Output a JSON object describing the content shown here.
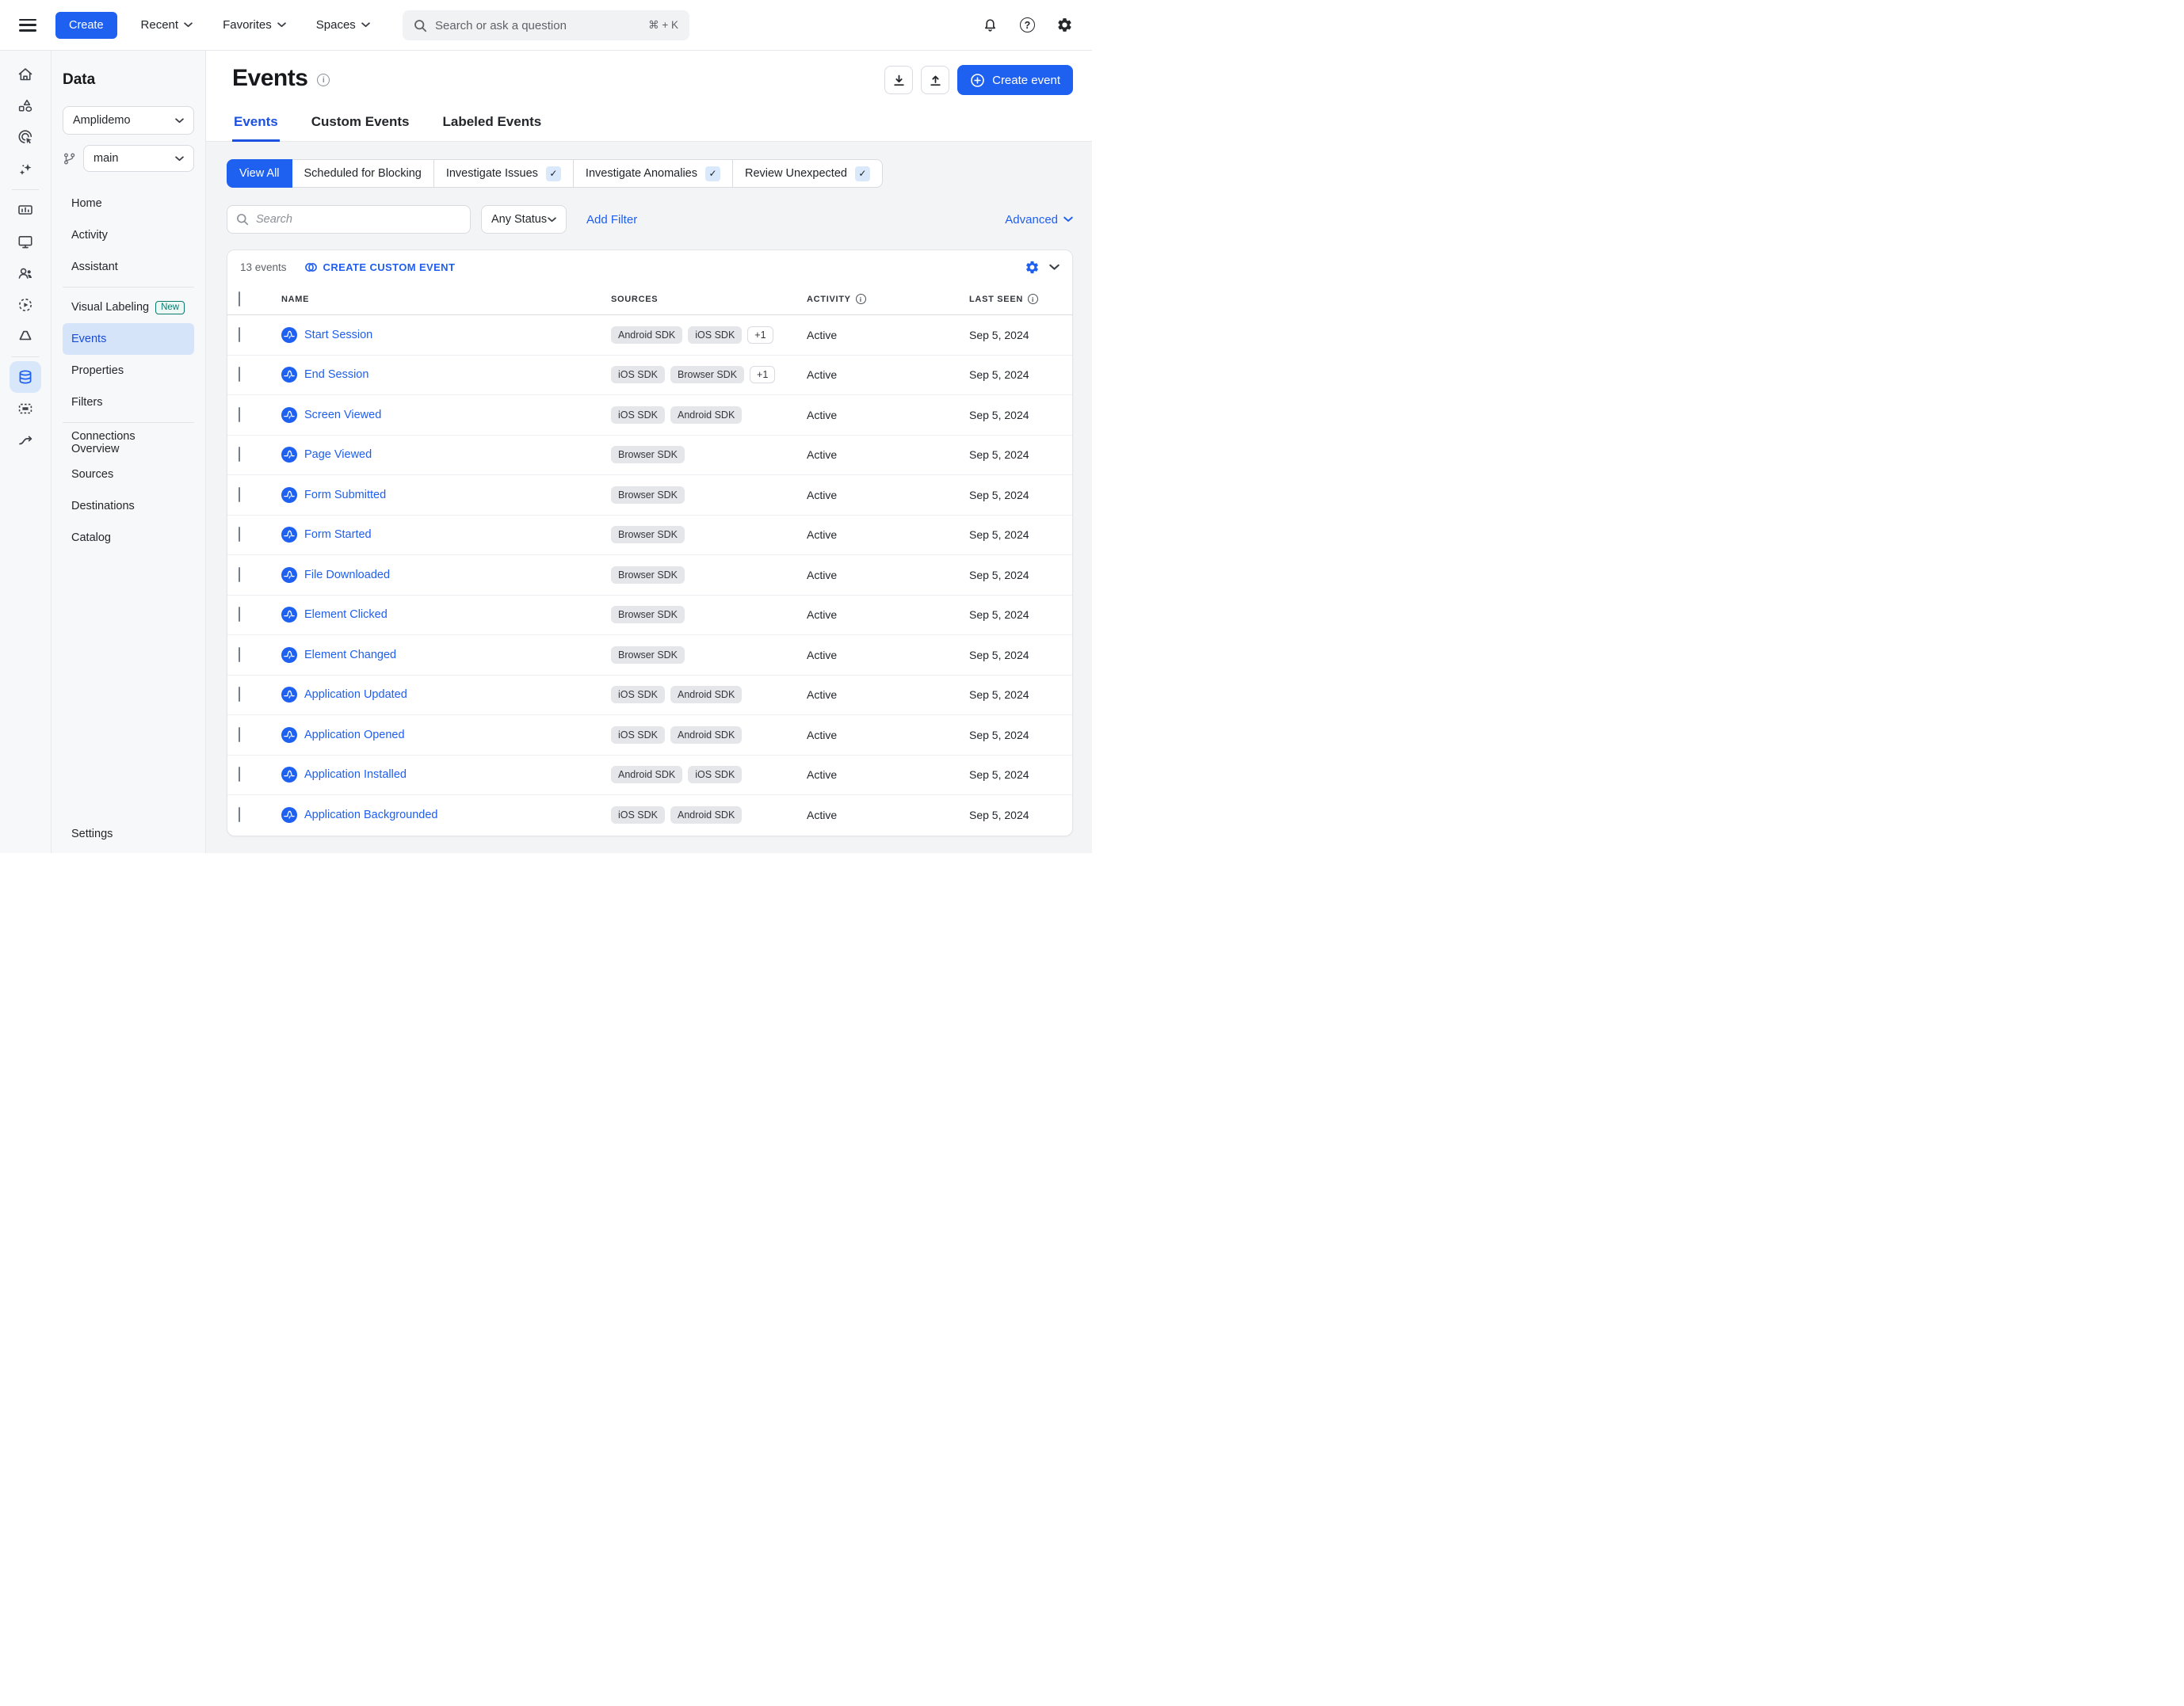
{
  "colors": {
    "accent": "#1E61F0",
    "link": "#1E5EF0",
    "active_nav_bg": "#D6E4FA",
    "page_bg": "#F3F4F6"
  },
  "topbar": {
    "create_label": "Create",
    "menus": [
      {
        "label": "Recent"
      },
      {
        "label": "Favorites"
      },
      {
        "label": "Spaces"
      }
    ],
    "search": {
      "placeholder": "Search or ask a question",
      "shortcut": "⌘ + K"
    },
    "right_icons": [
      "notifications-bell",
      "help-circle",
      "settings-gear"
    ]
  },
  "rail": {
    "items": [
      "home",
      "objects",
      "web-click",
      "ai-sparkles",
      "dashboards",
      "displays",
      "users",
      "session-replay",
      "experiments",
      "data",
      "selection-frame",
      "journeys"
    ],
    "active": "data"
  },
  "sidebar": {
    "title": "Data",
    "project_selector": "Amplidemo",
    "branch_selector": "main",
    "nav": [
      {
        "label": "Home"
      },
      {
        "label": "Activity"
      },
      {
        "label": "Assistant"
      },
      {
        "label": "Visual Labeling",
        "badge": "New"
      },
      {
        "label": "Events",
        "active": true
      },
      {
        "label": "Properties"
      },
      {
        "label": "Filters"
      },
      {
        "label": "Connections Overview"
      },
      {
        "label": "Sources"
      },
      {
        "label": "Destinations"
      },
      {
        "label": "Catalog"
      }
    ],
    "settings_label": "Settings"
  },
  "main": {
    "title": "Events",
    "create_event_label": "Create event",
    "tabs": [
      {
        "label": "Events",
        "active": true
      },
      {
        "label": "Custom Events"
      },
      {
        "label": "Labeled Events"
      }
    ],
    "filters": {
      "segments": [
        {
          "label": "View All",
          "active": true
        },
        {
          "label": "Scheduled for Blocking"
        },
        {
          "label": "Investigate Issues",
          "check": "✓"
        },
        {
          "label": "Investigate Anomalies",
          "check": "✓"
        },
        {
          "label": "Review Unexpected",
          "check": "✓"
        }
      ],
      "search_placeholder": "Search",
      "status_filter": "Any Status",
      "add_filter_label": "Add Filter",
      "advanced_label": "Advanced"
    },
    "table": {
      "count_label": "13 events",
      "create_custom_label": "CREATE CUSTOM EVENT",
      "columns": [
        "NAME",
        "SOURCES",
        "ACTIVITY",
        "LAST SEEN"
      ],
      "rows": [
        {
          "name": "Start Session",
          "sources": [
            "Android SDK",
            "iOS SDK"
          ],
          "extra": "+1",
          "activity": "Active",
          "last_seen": "Sep 5, 2024"
        },
        {
          "name": "End Session",
          "sources": [
            "iOS SDK",
            "Browser SDK"
          ],
          "extra": "+1",
          "activity": "Active",
          "last_seen": "Sep 5, 2024"
        },
        {
          "name": "Screen Viewed",
          "sources": [
            "iOS SDK",
            "Android SDK"
          ],
          "activity": "Active",
          "last_seen": "Sep 5, 2024"
        },
        {
          "name": "Page Viewed",
          "sources": [
            "Browser SDK"
          ],
          "activity": "Active",
          "last_seen": "Sep 5, 2024"
        },
        {
          "name": "Form Submitted",
          "sources": [
            "Browser SDK"
          ],
          "activity": "Active",
          "last_seen": "Sep 5, 2024"
        },
        {
          "name": "Form Started",
          "sources": [
            "Browser SDK"
          ],
          "activity": "Active",
          "last_seen": "Sep 5, 2024"
        },
        {
          "name": "File Downloaded",
          "sources": [
            "Browser SDK"
          ],
          "activity": "Active",
          "last_seen": "Sep 5, 2024"
        },
        {
          "name": "Element Clicked",
          "sources": [
            "Browser SDK"
          ],
          "activity": "Active",
          "last_seen": "Sep 5, 2024"
        },
        {
          "name": "Element Changed",
          "sources": [
            "Browser SDK"
          ],
          "activity": "Active",
          "last_seen": "Sep 5, 2024"
        },
        {
          "name": "Application Updated",
          "sources": [
            "iOS SDK",
            "Android SDK"
          ],
          "activity": "Active",
          "last_seen": "Sep 5, 2024"
        },
        {
          "name": "Application Opened",
          "sources": [
            "iOS SDK",
            "Android SDK"
          ],
          "activity": "Active",
          "last_seen": "Sep 5, 2024"
        },
        {
          "name": "Application Installed",
          "sources": [
            "Android SDK",
            "iOS SDK"
          ],
          "activity": "Active",
          "last_seen": "Sep 5, 2024"
        },
        {
          "name": "Application Backgrounded",
          "sources": [
            "iOS SDK",
            "Android SDK"
          ],
          "activity": "Active",
          "last_seen": "Sep 5, 2024"
        }
      ]
    }
  }
}
